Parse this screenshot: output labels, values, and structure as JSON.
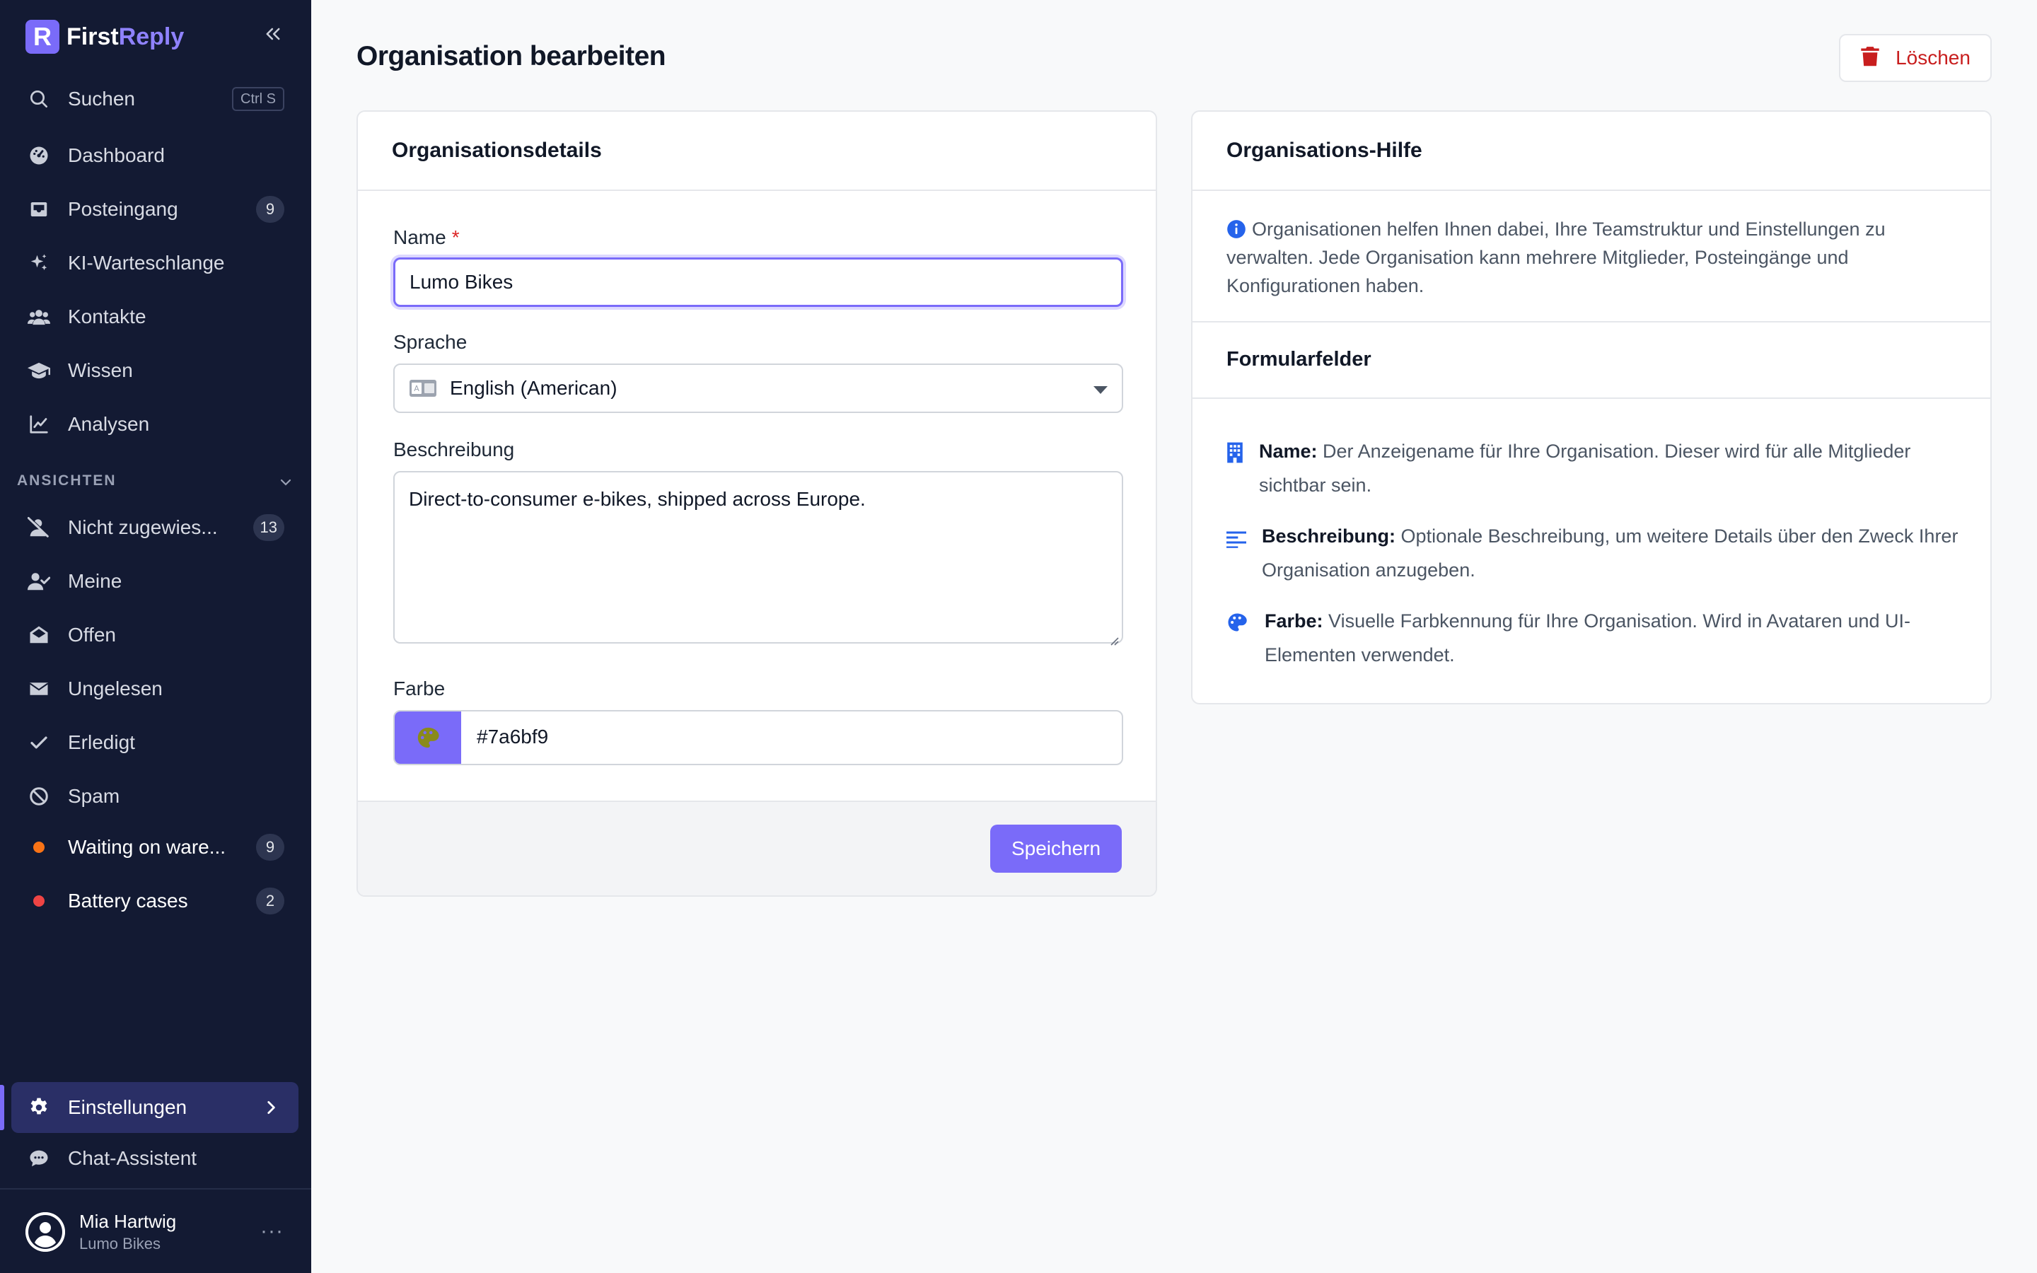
{
  "brand": {
    "name_prefix": "First",
    "name_suffix": "Reply",
    "logo_letter": "R"
  },
  "sidebar": {
    "search": {
      "label": "Suchen",
      "shortcut": "Ctrl S"
    },
    "nav": [
      {
        "id": "dashboard",
        "label": "Dashboard"
      },
      {
        "id": "inbox",
        "label": "Posteingang",
        "badge": "9"
      },
      {
        "id": "ai-queue",
        "label": "KI-Warteschlange"
      },
      {
        "id": "contacts",
        "label": "Kontakte"
      },
      {
        "id": "knowledge",
        "label": "Wissen"
      },
      {
        "id": "analytics",
        "label": "Analysen"
      }
    ],
    "views_section": "ANSICHTEN",
    "views": [
      {
        "id": "unassigned",
        "label": "Nicht zugewies...",
        "badge": "13"
      },
      {
        "id": "mine",
        "label": "Meine"
      },
      {
        "id": "open",
        "label": "Offen"
      },
      {
        "id": "unread",
        "label": "Ungelesen"
      },
      {
        "id": "done",
        "label": "Erledigt"
      },
      {
        "id": "spam",
        "label": "Spam"
      },
      {
        "id": "waiting",
        "label": "Waiting on ware...",
        "badge": "9",
        "dot_color": "#f97316"
      },
      {
        "id": "battery",
        "label": "Battery cases",
        "badge": "2",
        "dot_color": "#ef4444"
      }
    ],
    "settings": {
      "label": "Einstellungen"
    },
    "chat_assistant": {
      "label": "Chat-Assistent"
    },
    "user": {
      "name": "Mia Hartwig",
      "org": "Lumo Bikes",
      "more": "···"
    }
  },
  "page": {
    "title": "Organisation bearbeiten",
    "delete_label": "Löschen"
  },
  "form": {
    "card_title": "Organisationsdetails",
    "name": {
      "label": "Name",
      "required_mark": "*",
      "value": "Lumo Bikes"
    },
    "language": {
      "label": "Sprache",
      "value": "English (American)"
    },
    "description": {
      "label": "Beschreibung",
      "value": "Direct-to-consumer e-bikes, shipped across Europe."
    },
    "color": {
      "label": "Farbe",
      "value": "#7a6bf9"
    },
    "save_label": "Speichern"
  },
  "help": {
    "card_title": "Organisations-Hilfe",
    "intro": "Organisationen helfen Ihnen dabei, Ihre Teamstruktur und Einstellungen zu verwalten. Jede Organisation kann mehrere Mitglieder, Posteingänge und Konfigurationen haben.",
    "fields_title": "Formularfelder",
    "items": [
      {
        "term": "Name:",
        "text": "Der Anzeigename für Ihre Organisation. Dieser wird für alle Mitglieder sichtbar sein."
      },
      {
        "term": "Beschreibung:",
        "text": "Optionale Beschreibung, um weitere Details über den Zweck Ihrer Organisation anzugeben."
      },
      {
        "term": "Farbe:",
        "text": "Visuelle Farbkennung für Ihre Organisation. Wird in Avataren und UI-Elementen verwendet."
      }
    ]
  },
  "colors": {
    "accent": "#7a6bf9",
    "sidebar_bg": "#131a33",
    "danger": "#c81e1e",
    "help_icon": "#2563eb"
  }
}
